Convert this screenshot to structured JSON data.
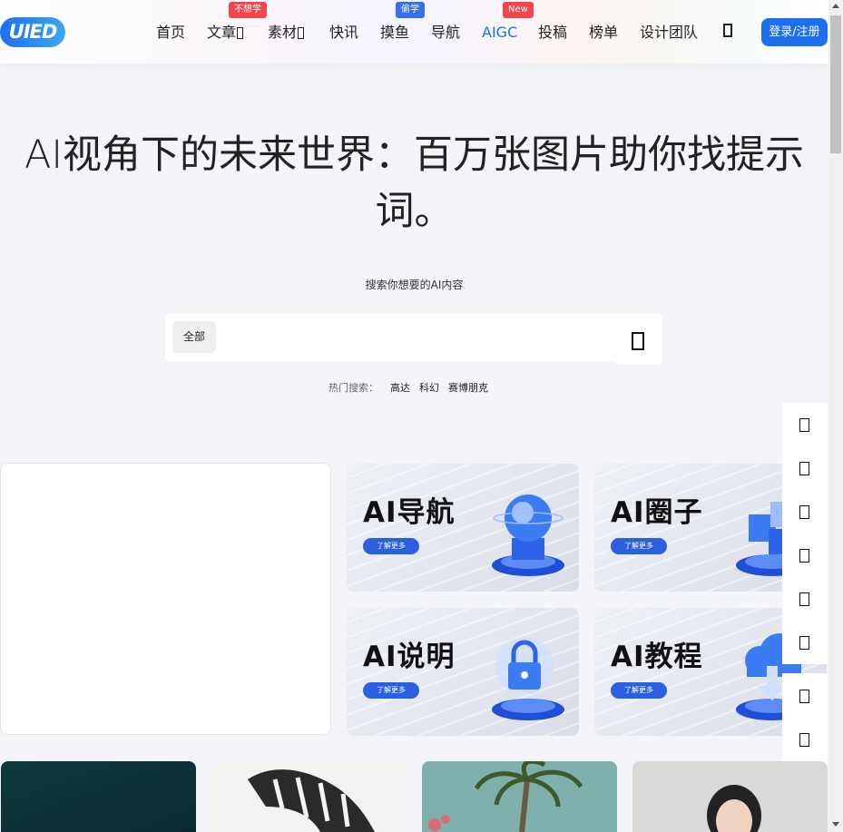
{
  "header": {
    "logo_text": "UIED",
    "nav": [
      {
        "label": "首页",
        "has_arrow": false
      },
      {
        "label": "文章",
        "has_arrow": true,
        "badge": "不想学",
        "badge_color": "#f0464d"
      },
      {
        "label": "素材",
        "has_arrow": true
      },
      {
        "label": "快讯",
        "has_arrow": false
      },
      {
        "label": "摸鱼",
        "has_arrow": false,
        "badge": "偷学",
        "badge_color": "#3a6fe6"
      },
      {
        "label": "导航",
        "has_arrow": false
      },
      {
        "label": "AIGC",
        "has_arrow": false,
        "badge": "New",
        "badge_color": "#f0464d",
        "active": true
      },
      {
        "label": "投稿",
        "has_arrow": false
      },
      {
        "label": "榜单",
        "has_arrow": false
      },
      {
        "label": "设计团队",
        "has_arrow": false
      }
    ],
    "search_icon": "search-icon",
    "login_label": "登录/注册"
  },
  "hero": {
    "title_line1": "AI视角下的未来世界：百万张图片助你找提示",
    "title_line2": "词。",
    "subtitle": "搜索你想要的AI内容"
  },
  "search": {
    "scope": "全部",
    "value": "",
    "placeholder": "",
    "button_icon": "search-icon"
  },
  "hot_search": {
    "label": "热门搜索：",
    "items": [
      "高达",
      "科幻",
      "赛博朋克"
    ]
  },
  "cards": [
    {
      "title": "AI导航",
      "button": "了解更多",
      "icon": "globe-icon"
    },
    {
      "title": "AI圈子",
      "button": "了解更多",
      "icon": "cubes-icon"
    },
    {
      "title": "AI说明",
      "button": "了解更多",
      "icon": "lock-icon"
    },
    {
      "title": "AI教程",
      "button": "了解更多",
      "icon": "cloud-download-icon"
    }
  ],
  "side_tools": [
    "tool-icon",
    "tool-icon",
    "tool-icon",
    "tool-icon",
    "tool-icon",
    "tool-icon",
    "tool-icon",
    "tool-icon",
    "tool-icon"
  ],
  "gallery": [
    {
      "name": "dark-teal-image"
    },
    {
      "name": "ink-tiger-image"
    },
    {
      "name": "palm-tree-image"
    },
    {
      "name": "portrait-image"
    }
  ],
  "colors": {
    "accent": "#1e6ff0",
    "badge_red": "#f0464d",
    "badge_blue": "#3a6fe6",
    "card_button": "#2a5fe0"
  }
}
